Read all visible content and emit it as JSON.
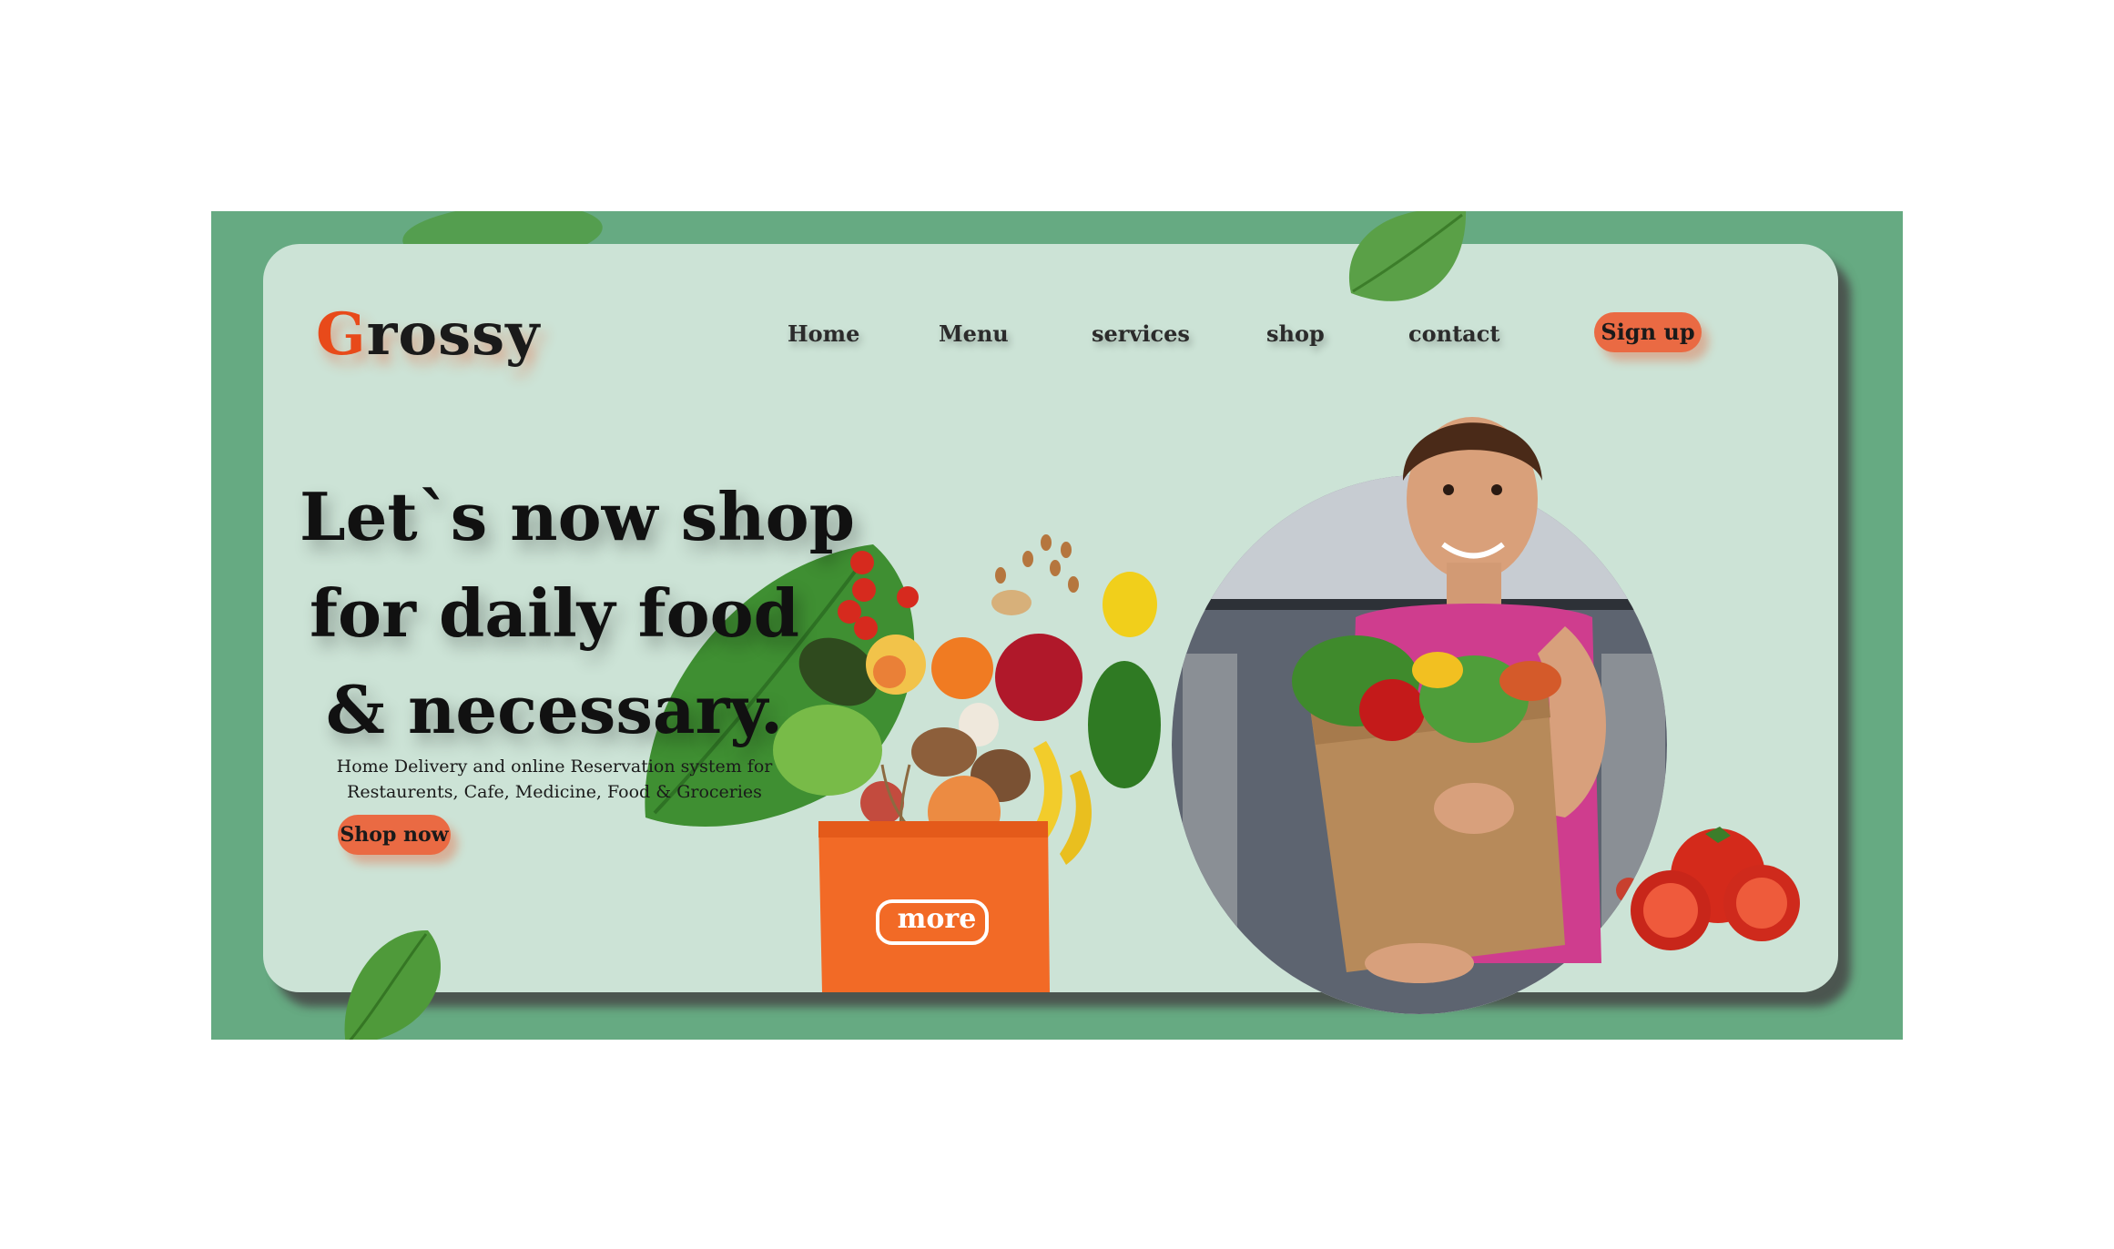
{
  "brand": {
    "first_letter": "G",
    "rest": "rossy"
  },
  "nav": {
    "items": [
      {
        "label": "Home"
      },
      {
        "label": "Menu"
      },
      {
        "label": "services"
      },
      {
        "label": "shop"
      },
      {
        "label": "contact"
      }
    ],
    "signup_label": "Sign up"
  },
  "hero": {
    "headline_lines": [
      "Let`s now shop",
      "for daily food",
      "& necessary."
    ],
    "subtitle_lines": [
      "Home Delivery and online Reservation system for",
      "Restaurents, Cafe, Medicine, Food & Groceries"
    ],
    "cta_label": "Shop now",
    "bag_label": "more"
  },
  "colors": {
    "frame": "#66aa82",
    "card": "#cce3d6",
    "accent": "#ea6a43",
    "logo_accent": "#e84a1a"
  }
}
